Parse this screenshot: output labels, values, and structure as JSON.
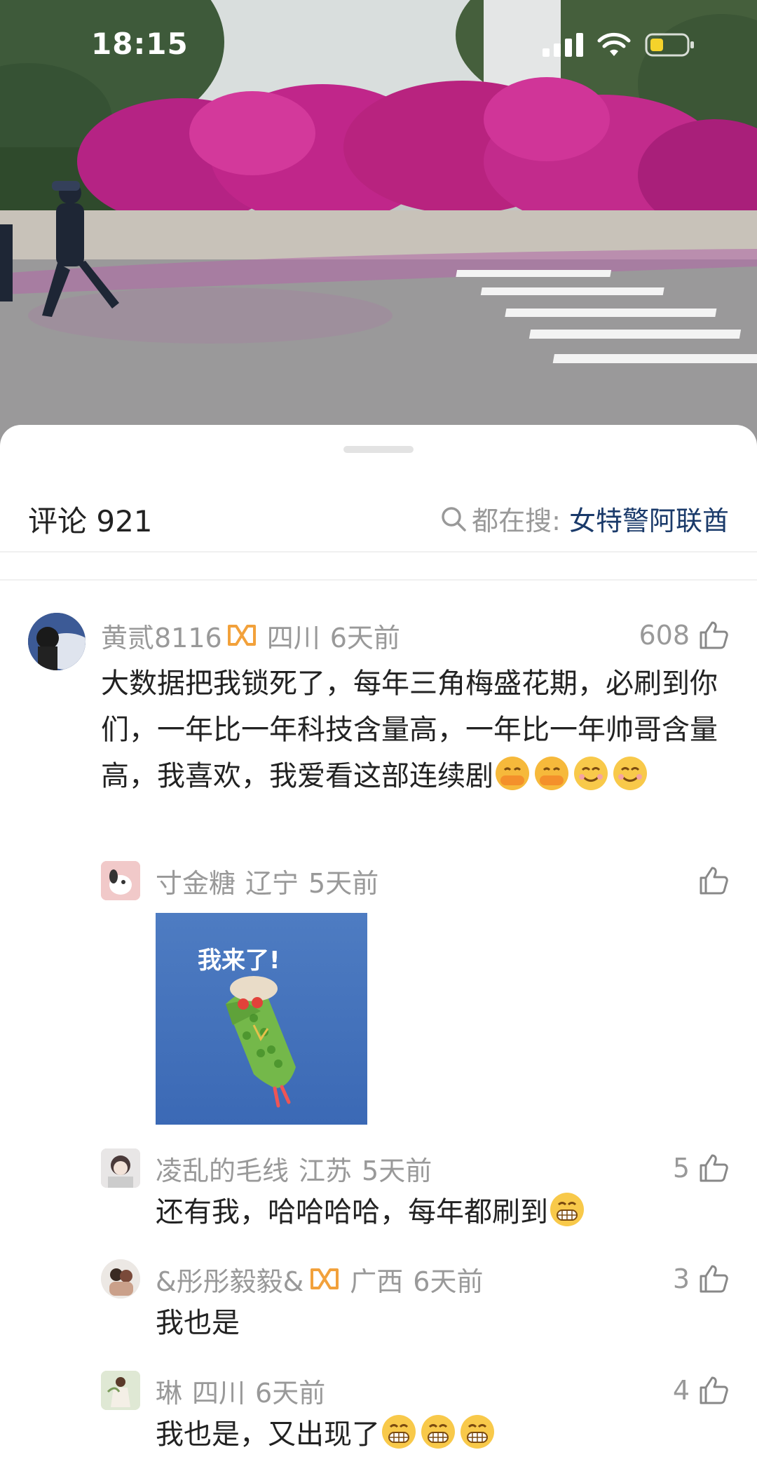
{
  "status_bar": {
    "time": "18:15"
  },
  "comments_panel": {
    "title": "评论 921",
    "search_prefix": "都在搜:",
    "search_keyword": "女特警阿联酋"
  },
  "comments": [
    {
      "user": "黄贰8116",
      "region": "四川",
      "time": "6天前",
      "likes": "608",
      "text": "大数据把我锁死了，每年三角梅盛花期，必刷到你们，一年比一年科技含量高，一年比一年帅哥含量高，我喜欢，我爱看这部连续剧"
    },
    {
      "user": "寸金糖",
      "region": "辽宁",
      "time": "5天前",
      "likes": "",
      "sticker_text": "我来了!"
    },
    {
      "user": "凌乱的毛线",
      "region": "江苏",
      "time": "5天前",
      "likes": "5",
      "text": "还有我，哈哈哈哈，每年都刷到"
    },
    {
      "user": "&彤彤毅毅&",
      "region": "广西",
      "time": "6天前",
      "likes": "3",
      "text": "我也是"
    },
    {
      "user": "琳",
      "region": "四川",
      "time": "6天前",
      "likes": "4",
      "text": "我也是，又出现了"
    }
  ],
  "colors": {
    "meta_gray": "#999999",
    "keyword_blue": "#1a3a6a",
    "badge_orange": "#f2a13b",
    "flower_magenta": "#c0268a"
  }
}
